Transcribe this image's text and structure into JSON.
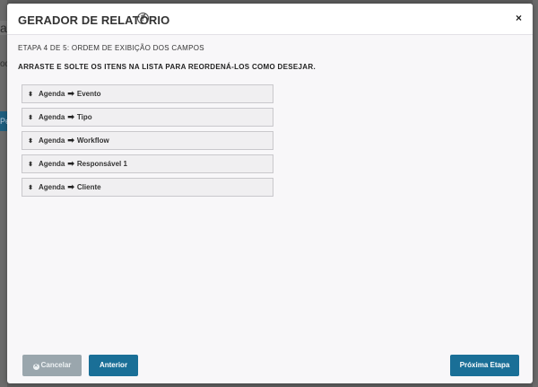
{
  "background": {
    "fragments": [
      "at",
      "od",
      "",
      "Pe",
      ""
    ]
  },
  "modal": {
    "title": "GERADOR DE RELATÓRIO",
    "help_icon": "question-circle-icon",
    "close_label": "×"
  },
  "step": {
    "label": "ETAPA 4 DE 5: ORDEM DE EXIBIÇÃO DOS CAMPOS"
  },
  "instruction": "ARRASTE E SOLTE OS ITENS NA LISTA PARA REORDENÁ-LOS COMO DESEJAR.",
  "fields": [
    {
      "group": "Agenda",
      "field": "Evento"
    },
    {
      "group": "Agenda",
      "field": "Tipo"
    },
    {
      "group": "Agenda",
      "field": "Workflow"
    },
    {
      "group": "Agenda",
      "field": "Responsável 1"
    },
    {
      "group": "Agenda",
      "field": "Cliente"
    }
  ],
  "buttons": {
    "cancel": "Cancelar",
    "previous": "Anterior",
    "next": "Próxima Etapa"
  },
  "colors": {
    "primary": "#1a6f97",
    "cancel": "#9aa6ad",
    "overlay": "#5c5c5c",
    "modal_bg": "#f8f7f9"
  }
}
